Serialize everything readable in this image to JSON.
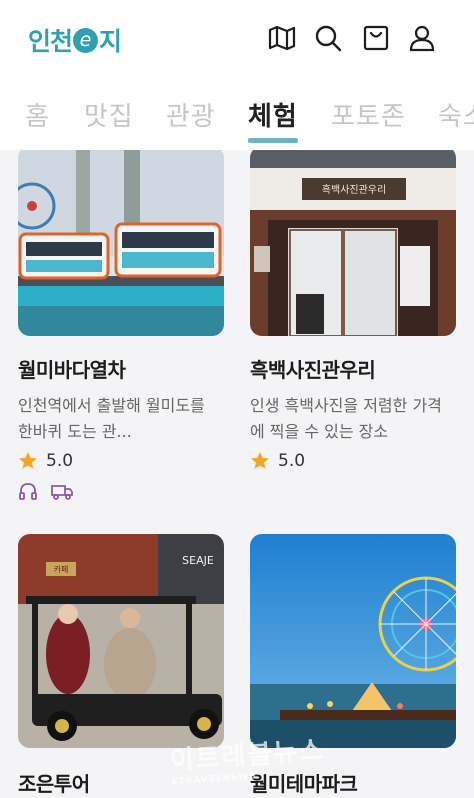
{
  "header": {
    "logo_text_left": "인천",
    "logo_e": "e",
    "logo_text_right": "지",
    "icons": [
      "map-icon",
      "search-icon",
      "shopping-bag-icon",
      "user-icon"
    ]
  },
  "tabs": [
    {
      "label": "홈"
    },
    {
      "label": "맛집"
    },
    {
      "label": "관광"
    },
    {
      "label": "체험"
    },
    {
      "label": "포토존"
    },
    {
      "label": "숙소"
    }
  ],
  "active_tab": "체험",
  "cards": [
    {
      "title": "월미바다열차",
      "description": "인천역에서 출발해 월미도를 한바퀴 도는 관...",
      "rating": "5.0",
      "amenities": [
        "headphones-icon",
        "bus-icon"
      ]
    },
    {
      "title": "흑백사진관우리",
      "description": "인생 흑백사진을 저렴한 가격에 찍을 수 있는 장소",
      "rating": "5.0",
      "image_sign": "흑백사진관우리",
      "amenities": []
    },
    {
      "title": "조은투어",
      "store_sign": "SEAJE",
      "sign_small": "카페"
    },
    {
      "title": "월미테마파크"
    }
  ],
  "watermark": {
    "text": "이트레블뉴스",
    "sub": "ETRAVELNEWS"
  },
  "colors": {
    "brand": "#2f9fb4",
    "star": "#f5a623",
    "tab_underline": "#6fb3c2",
    "amenity_icon": "#8a5aa8"
  }
}
